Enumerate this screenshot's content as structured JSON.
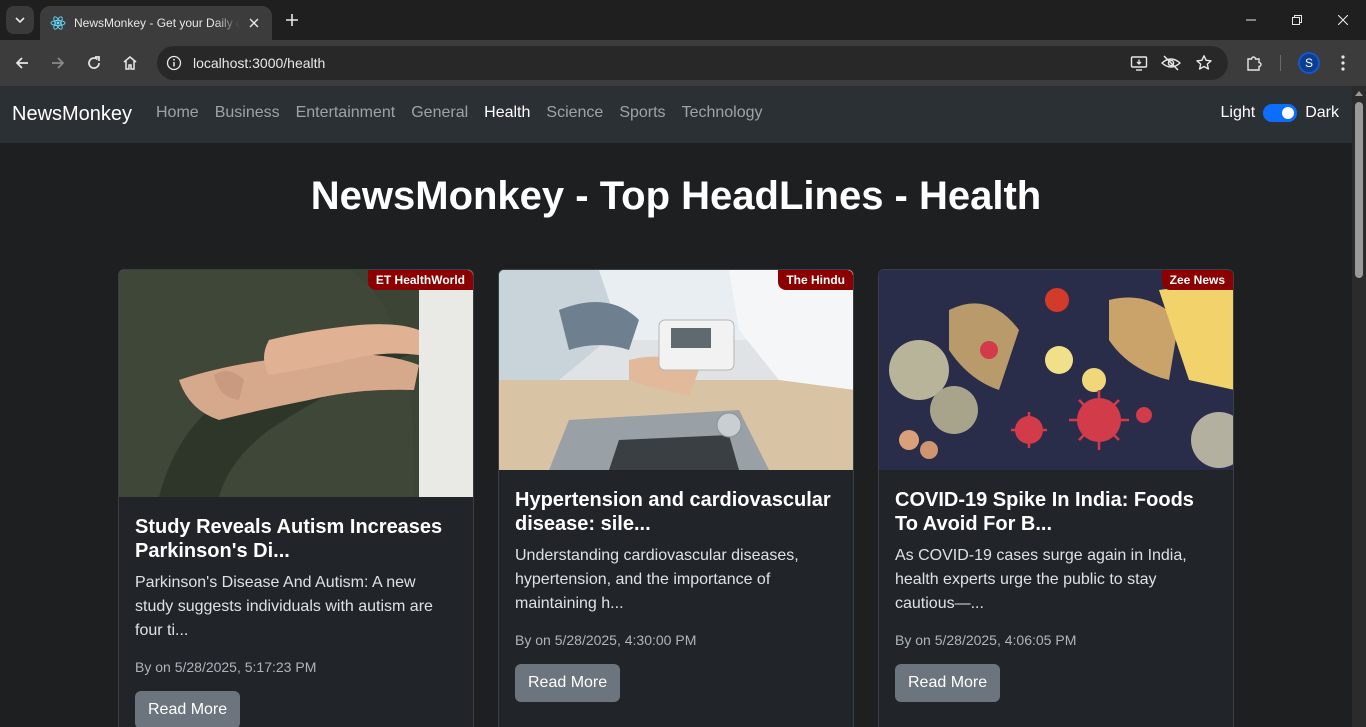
{
  "browser": {
    "tab_title": "NewsMonkey - Get your Daily dose of news",
    "url": "localhost:3000/health"
  },
  "navbar": {
    "brand": "NewsMonkey",
    "links": [
      "Home",
      "Business",
      "Entertainment",
      "General",
      "Health",
      "Science",
      "Sports",
      "Technology"
    ],
    "active": "Health",
    "theme_light_label": "Light",
    "theme_dark_label": "Dark"
  },
  "page": {
    "heading": "NewsMonkey - Top HeadLines - Health"
  },
  "articles": [
    {
      "source": "ET HealthWorld",
      "title": "Study Reveals Autism Increases Parkinson's Di...",
      "description": "Parkinson's Disease And Autism: A new study suggests individuals with autism are four ti...",
      "meta": "By on 5/28/2025, 5:17:23 PM",
      "button": "Read More"
    },
    {
      "source": "The Hindu",
      "title": "Hypertension and cardiovascular disease: sile...",
      "description": "Understanding cardiovascular diseases, hypertension, and the importance of maintaining h...",
      "meta": "By on 5/28/2025, 4:30:00 PM",
      "button": "Read More"
    },
    {
      "source": "Zee News",
      "title": "COVID-19 Spike In India: Foods To Avoid For B...",
      "description": "As COVID-19 cases surge again in India, health experts urge the public to stay cautious—...",
      "meta": "By on 5/28/2025, 4:06:05 PM",
      "button": "Read More"
    }
  ],
  "profile_initial": "S"
}
